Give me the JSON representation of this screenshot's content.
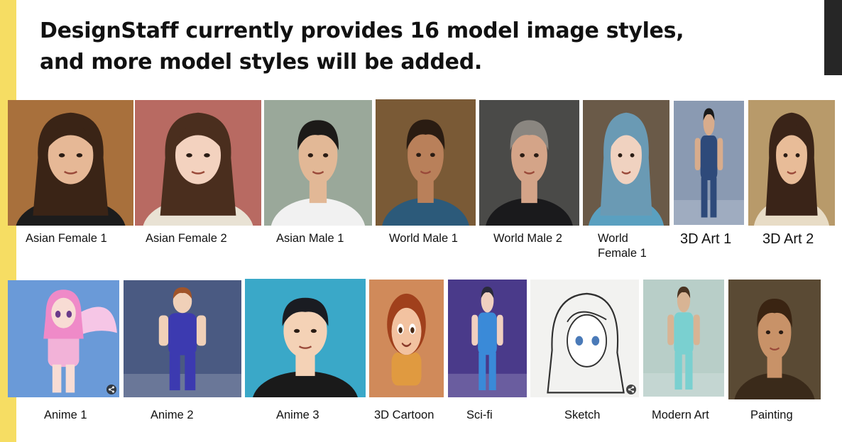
{
  "headline": {
    "line1": "DesignStaff currently provides 16 model image styles,",
    "line2": "and more model styles will be added."
  },
  "row1": [
    {
      "id": "asian-female-1",
      "label": "Asian Female 1",
      "icon": "woman-portrait",
      "colors": {
        "bg": "#a8703c",
        "skin": "#e6b896",
        "hair": "#3a2416",
        "cloth": "#1c1c1c"
      }
    },
    {
      "id": "asian-female-2",
      "label": "Asian Female 2",
      "icon": "woman-portrait",
      "colors": {
        "bg": "#b86a62",
        "skin": "#f3d2bf",
        "hair": "#4a2e1e",
        "cloth": "#e9e2d4"
      }
    },
    {
      "id": "asian-male-1",
      "label": "Asian Male 1",
      "icon": "man-portrait",
      "colors": {
        "bg": "#9aa89a",
        "skin": "#e2b896",
        "hair": "#1c1a18",
        "cloth": "#f1f1f1"
      }
    },
    {
      "id": "world-male-1",
      "label": "World Male 1",
      "icon": "man-portrait",
      "colors": {
        "bg": "#7a5a36",
        "skin": "#b9805a",
        "hair": "#2a1c12",
        "cloth": "#2c5a7a"
      }
    },
    {
      "id": "world-male-2",
      "label": "World Male 2",
      "icon": "man-portrait",
      "colors": {
        "bg": "#4a4a48",
        "skin": "#d4a488",
        "hair": "#8a8680",
        "cloth": "#1a1a1c"
      }
    },
    {
      "id": "world-female-1",
      "label": "World Female 1",
      "icon": "woman-portrait",
      "colors": {
        "bg": "#6a5a48",
        "skin": "#f0d2c0",
        "hair": "#6a9ab4",
        "cloth": "#5aa0c0"
      }
    },
    {
      "id": "3d-art-1",
      "label": "3D Art 1",
      "icon": "full-body-figure",
      "colors": {
        "bg": "#8a9ab2",
        "skin": "#d8ac8c",
        "hair": "#1a1a1a",
        "cloth": "#2e4a7a"
      }
    },
    {
      "id": "3d-art-2",
      "label": "3D Art 2",
      "icon": "woman-portrait",
      "colors": {
        "bg": "#b89a6a",
        "skin": "#e8bc98",
        "hair": "#3a2418",
        "cloth": "#e8dcc6"
      }
    }
  ],
  "row2": [
    {
      "id": "anime-1",
      "label": "Anime 1",
      "icon": "anime-figure",
      "colors": {
        "bg": "#6a9ad8",
        "skin": "#f8dcd4",
        "hair": "#ef8ac8",
        "cloth": "#f2b2d8"
      }
    },
    {
      "id": "anime-2",
      "label": "Anime 2",
      "icon": "full-body-figure",
      "colors": {
        "bg": "#4a5a82",
        "skin": "#f0d0b8",
        "hair": "#a0542a",
        "cloth": "#3c3ab0"
      }
    },
    {
      "id": "anime-3",
      "label": "Anime 3",
      "icon": "man-portrait",
      "colors": {
        "bg": "#3aa8c8",
        "skin": "#f4d2b6",
        "hair": "#1a1c22",
        "cloth": "#1a1a1a"
      }
    },
    {
      "id": "3d-cartoon",
      "label": "3D Cartoon",
      "icon": "cartoon-figure",
      "colors": {
        "bg": "#d08a5a",
        "skin": "#f2c2a0",
        "hair": "#a0401c",
        "cloth": "#e09a40"
      }
    },
    {
      "id": "sci-fi",
      "label": "Sci-fi",
      "icon": "full-body-figure",
      "colors": {
        "bg": "#4a3a8a",
        "skin": "#f0d0c0",
        "hair": "#2a2a3a",
        "cloth": "#3a8ad8"
      }
    },
    {
      "id": "sketch",
      "label": "Sketch",
      "icon": "sketch-portrait",
      "colors": {
        "bg": "#f2f2f0",
        "skin": "#ffffff",
        "hair": "#303030",
        "cloth": "#d8d8d8"
      }
    },
    {
      "id": "modern-art",
      "label": "Modern Art",
      "icon": "full-body-figure",
      "colors": {
        "bg": "#b8cec8",
        "skin": "#d8b494",
        "hair": "#4a3422",
        "cloth": "#7ad0d0"
      }
    },
    {
      "id": "painting",
      "label": "Painting",
      "icon": "man-portrait",
      "colors": {
        "bg": "#5a4a34",
        "skin": "#c89268",
        "hair": "#3a2412",
        "cloth": "#3a2a1a"
      }
    }
  ],
  "share_icon": "share-icon"
}
